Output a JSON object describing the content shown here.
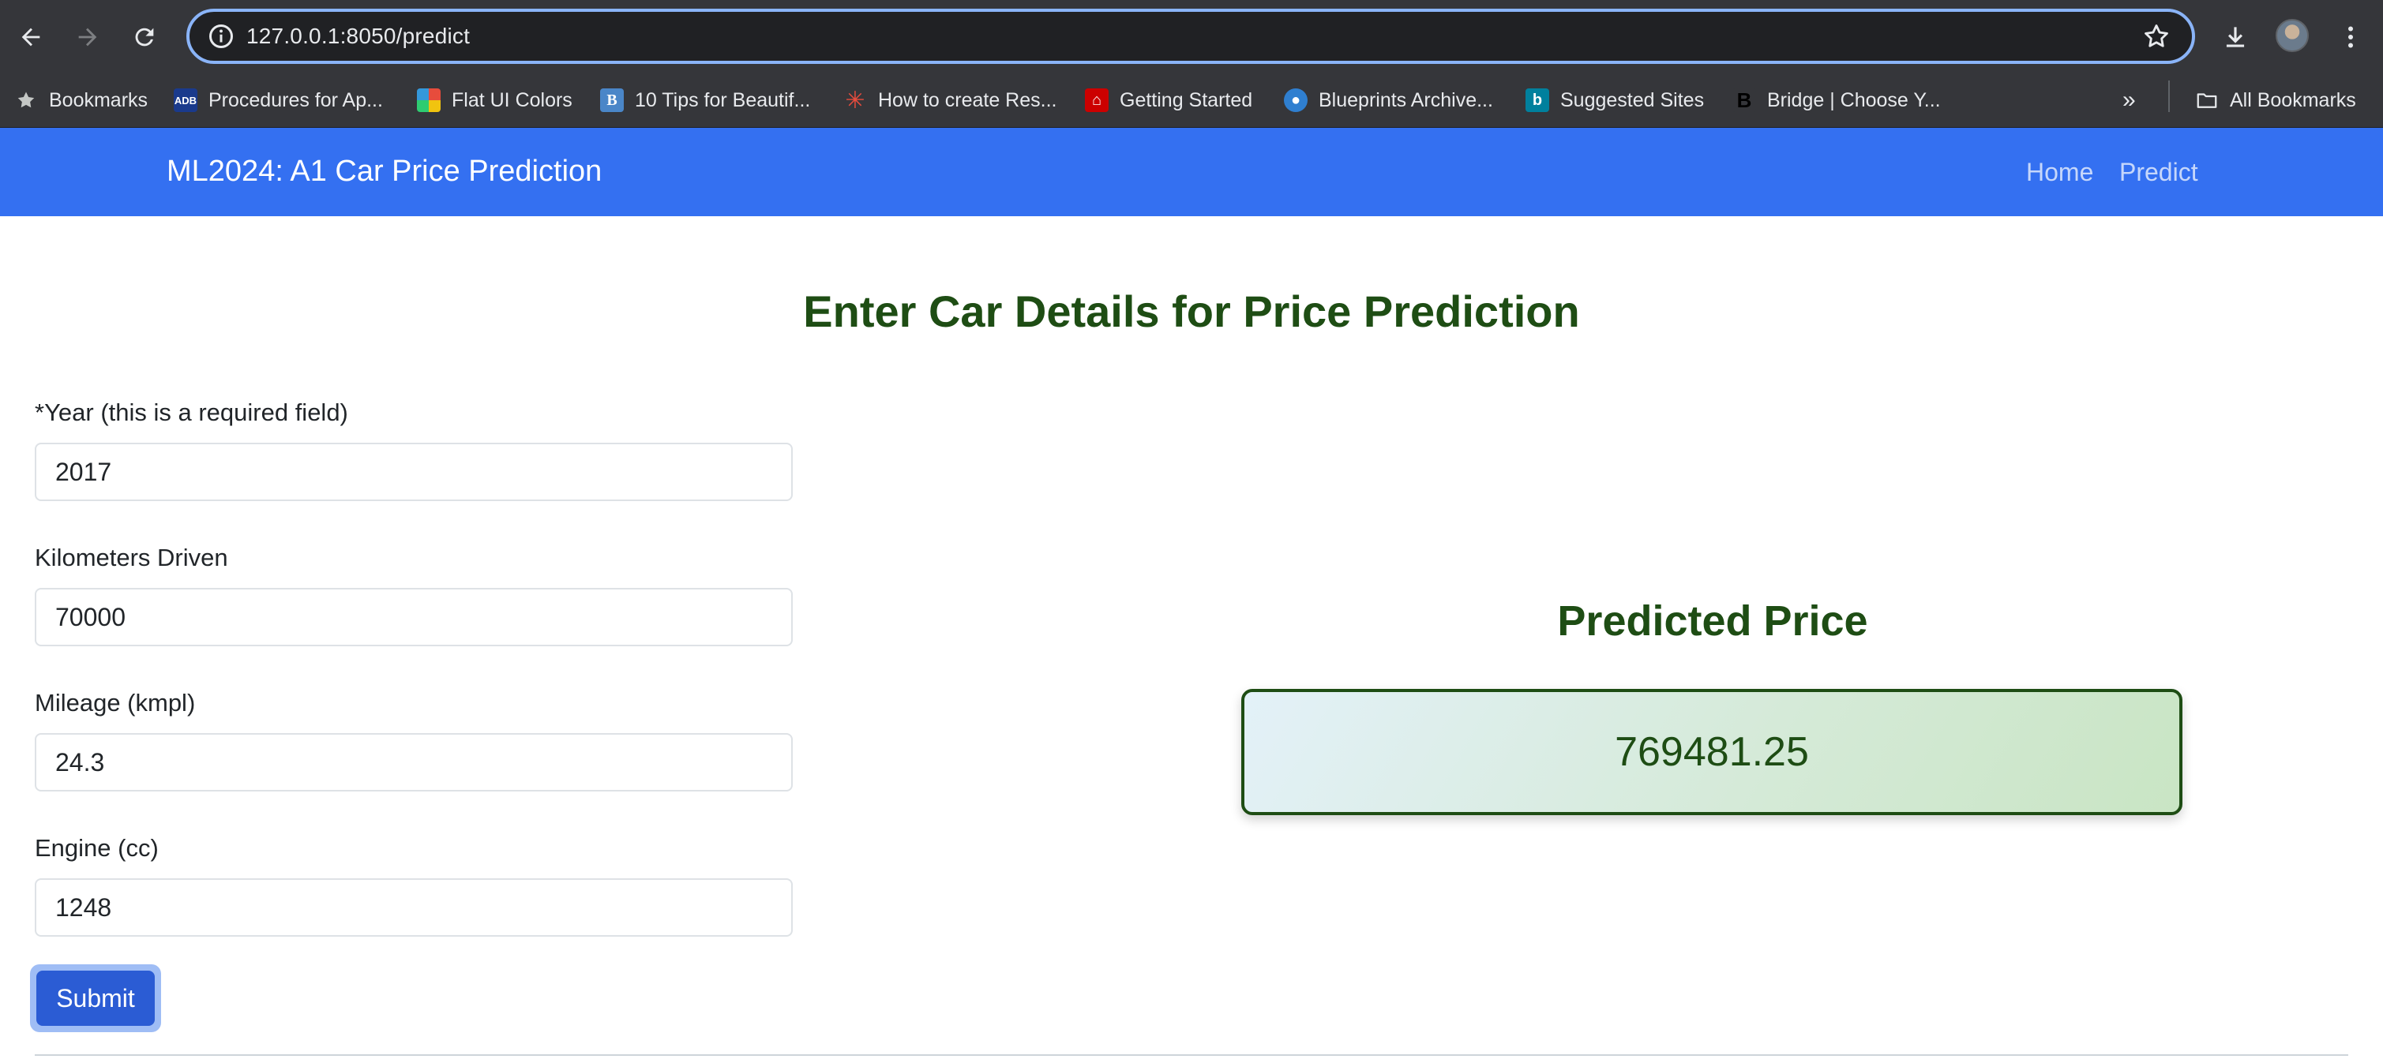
{
  "browser": {
    "url": "127.0.0.1:8050/predict",
    "icons": [
      "back-arrow-icon",
      "forward-arrow-icon",
      "reload-icon",
      "site-info-icon",
      "bookmark-star-icon",
      "download-icon",
      "profile-avatar",
      "more-menu-icon"
    ],
    "bookmarks": [
      {
        "label": "Bookmarks",
        "icon": "star-icon"
      },
      {
        "label": "Procedures for Ap...",
        "icon": "adb-favicon"
      },
      {
        "label": "Flat UI Colors",
        "icon": "flat-ui-favicon"
      },
      {
        "label": "10 Tips for Beautif...",
        "icon": "tips-favicon"
      },
      {
        "label": "How to create Res...",
        "icon": "asterisk-favicon"
      },
      {
        "label": "Getting Started",
        "icon": "getting-started-favicon"
      },
      {
        "label": "Blueprints Archive...",
        "icon": "drop-favicon"
      },
      {
        "label": "Suggested Sites",
        "icon": "bing-favicon"
      },
      {
        "label": "Bridge | Choose Y...",
        "icon": "bridge-favicon"
      }
    ],
    "overflow_label": "»",
    "all_bookmarks": "All Bookmarks"
  },
  "navbar": {
    "brand": "ML2024: A1 Car Price Prediction",
    "links": [
      "Home",
      "Predict"
    ],
    "bg_color": "#3470f1"
  },
  "form": {
    "title": "Enter Car Details for Price Prediction",
    "fields": [
      {
        "label": "*Year (this is a required field)",
        "value": "2017"
      },
      {
        "label": "Kilometers Driven",
        "value": "70000"
      },
      {
        "label": "Mileage (kmpl)",
        "value": "24.3"
      },
      {
        "label": "Engine (cc)",
        "value": "1248"
      }
    ],
    "submit_label": "Submit"
  },
  "result": {
    "heading": "Predicted Price",
    "value": "769481.25",
    "accent_color": "#1e4d14"
  }
}
